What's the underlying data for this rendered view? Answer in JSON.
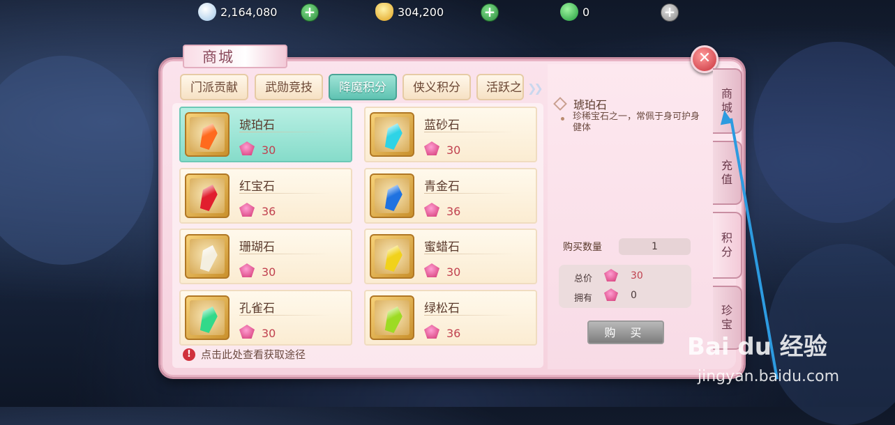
{
  "resources": [
    {
      "value": "2,164,080",
      "icon": "silver-coin-icon"
    },
    {
      "value": "304,200",
      "icon": "gold-ingot-icon"
    },
    {
      "value": "0",
      "icon": "jade-icon"
    }
  ],
  "title": "商城",
  "tabs": [
    "门派贡献",
    "武勋竞技",
    "降魔积分",
    "侠义积分",
    "活跃之"
  ],
  "items": [
    {
      "name": "琥珀石",
      "price": "30",
      "color": "#ff6a1e"
    },
    {
      "name": "蓝砂石",
      "price": "30",
      "color": "#2ed3e6"
    },
    {
      "name": "红宝石",
      "price": "36",
      "color": "#e11e2e"
    },
    {
      "name": "青金石",
      "price": "36",
      "color": "#1f72e0"
    },
    {
      "name": "珊瑚石",
      "price": "30",
      "color": "#f4efe0"
    },
    {
      "name": "蜜蜡石",
      "price": "30",
      "color": "#f1d21b"
    },
    {
      "name": "孔雀石",
      "price": "30",
      "color": "#32d98a"
    },
    {
      "name": "绿松石",
      "price": "36",
      "color": "#9ddb24"
    }
  ],
  "hint": "点击此处查看获取途径",
  "detail": {
    "name": "琥珀石",
    "description": "珍稀宝石之一，常佩于身可护身健体",
    "qty_label": "购买数量",
    "qty": "1",
    "total_label": "总价",
    "total": "30",
    "own_label": "拥有",
    "own": "0",
    "buy": "购 买"
  },
  "side_tabs": [
    "商城",
    "充值",
    "积分",
    "珍宝"
  ],
  "watermark": {
    "brand": "Bai du 经验",
    "url": "jingyan.baidu.com"
  }
}
